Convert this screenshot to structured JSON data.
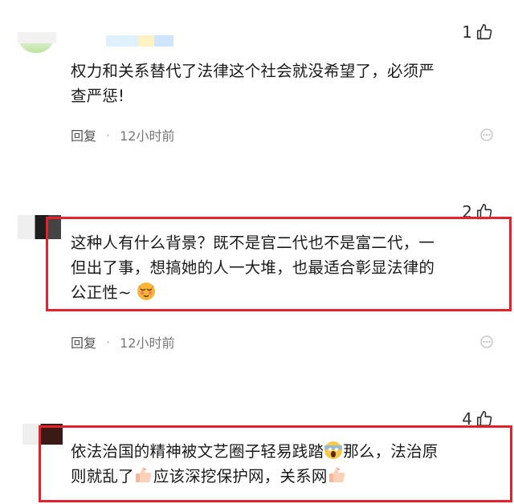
{
  "comments": [
    {
      "likes": "1",
      "text_lines": [
        "权力和关系替代了法律这个社会就没希望了，必须严",
        "查严惩!"
      ],
      "reply_label": "回复",
      "time": "12小时前"
    },
    {
      "likes": "2",
      "text_lines": [
        "这种人有什么背景？既不是官二代也不是富二代，一",
        "但出了事，想搞她的人一大堆，也最适合彰显法律的",
        "公正性~"
      ],
      "reply_label": "回复",
      "time": "12小时前"
    },
    {
      "likes": "4",
      "text_lines": [
        "依法治国的精神被文艺圈子轻易践踏",
        "那么，法治原",
        "则就乱了",
        "应该深挖保护网，关系网"
      ]
    }
  ],
  "icons": {
    "like": "thumbs-up-icon",
    "more": "more-icon",
    "emoji_heart_eyes": "hot-face-emoji",
    "emoji_scream": "face-screaming-emoji",
    "emoji_thumb": "thumbs-up-emoji"
  },
  "colors": {
    "highlight": "#e5212b"
  }
}
